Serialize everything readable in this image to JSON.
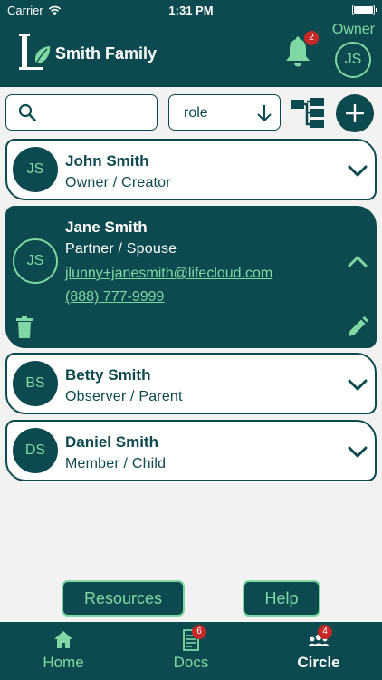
{
  "status_bar": {
    "carrier": "Carrier",
    "time": "1:31 PM"
  },
  "header": {
    "family_name": "Smith Family",
    "notification_count": "2",
    "owner_label": "Owner",
    "user_initials": "JS"
  },
  "toolbar": {
    "search_value": "",
    "search_placeholder": "",
    "role_label": "role"
  },
  "members": [
    {
      "initials": "JS",
      "name": "John Smith",
      "role": "Owner / Creator",
      "expanded": false
    },
    {
      "initials": "JS",
      "name": "Jane Smith",
      "role": "Partner / Spouse",
      "email": "jlunny+janesmith@lifecloud.com",
      "phone": "(888) 777-9999",
      "expanded": true
    },
    {
      "initials": "BS",
      "name": "Betty Smith",
      "role": "Observer / Parent",
      "expanded": false
    },
    {
      "initials": "DS",
      "name": "Daniel Smith",
      "role": "Member / Child",
      "expanded": false
    }
  ],
  "bottom_buttons": {
    "resources": "Resources",
    "help": "Help"
  },
  "tabs": [
    {
      "label": "Home",
      "badge": ""
    },
    {
      "label": "Docs",
      "badge": "6"
    },
    {
      "label": "Circle",
      "badge": "4",
      "active": true
    }
  ],
  "colors": {
    "primary": "#0d4a4f",
    "accent": "#7fd8a3",
    "badge": "#c62828",
    "background": "#f2f2f2"
  }
}
